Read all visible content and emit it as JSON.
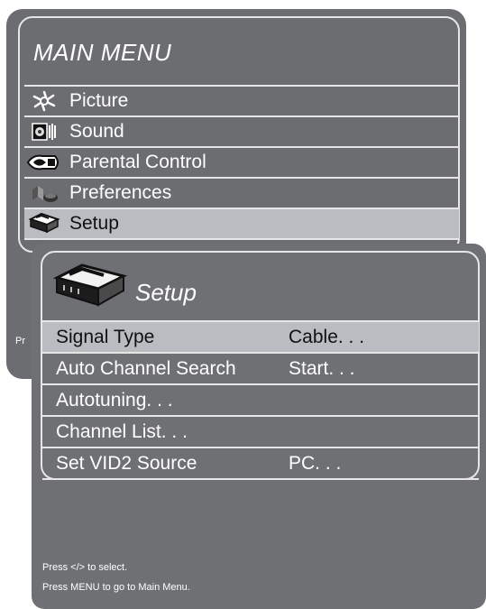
{
  "main_menu": {
    "title": "MAIN MENU",
    "items": [
      {
        "label": "Picture",
        "icon": "picture-icon"
      },
      {
        "label": "Sound",
        "icon": "sound-icon"
      },
      {
        "label": "Parental Control",
        "icon": "parental-control-icon"
      },
      {
        "label": "Preferences",
        "icon": "preferences-icon"
      },
      {
        "label": "Setup",
        "icon": "setup-icon",
        "selected": true
      }
    ],
    "footer_partial": "Pr"
  },
  "setup_menu": {
    "title": "Setup",
    "items": [
      {
        "name": "Signal Type",
        "value": "Cable. . .",
        "selected": true
      },
      {
        "name": "Auto Channel Search",
        "value": "Start. . ."
      },
      {
        "name": "Autotuning. . .",
        "value": ""
      },
      {
        "name": "Channel List. . .",
        "value": ""
      },
      {
        "name": "Set VID2 Source",
        "value": "PC. . ."
      }
    ],
    "help": [
      "Press </> to select.",
      "Press MENU to go to Main Menu."
    ]
  },
  "colors": {
    "panel": "#6b6d70",
    "highlight": "#b9bcc0",
    "border": "#e6e6e6",
    "text": "#ffffff"
  }
}
